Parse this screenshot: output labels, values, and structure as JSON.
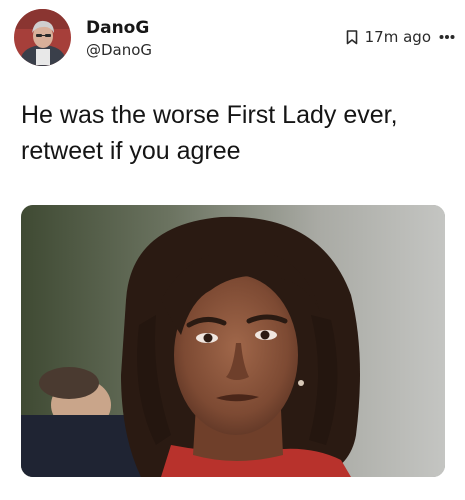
{
  "author": {
    "display_name": "DanoG",
    "handle": "@DanoG",
    "avatar_icon": "person-avatar-icon"
  },
  "meta": {
    "timestamp": "17m ago",
    "bookmark_icon": "bookmark-icon",
    "more_icon": "more-options-icon"
  },
  "post": {
    "text_line_1": "He was the worse First Lady ever,",
    "text_line_2": "retweet if you agree",
    "image_icon": "photo-of-woman-frowning"
  },
  "colors": {
    "text_primary": "#151515",
    "text_secondary": "#2b2b2b",
    "background": "#ffffff"
  }
}
